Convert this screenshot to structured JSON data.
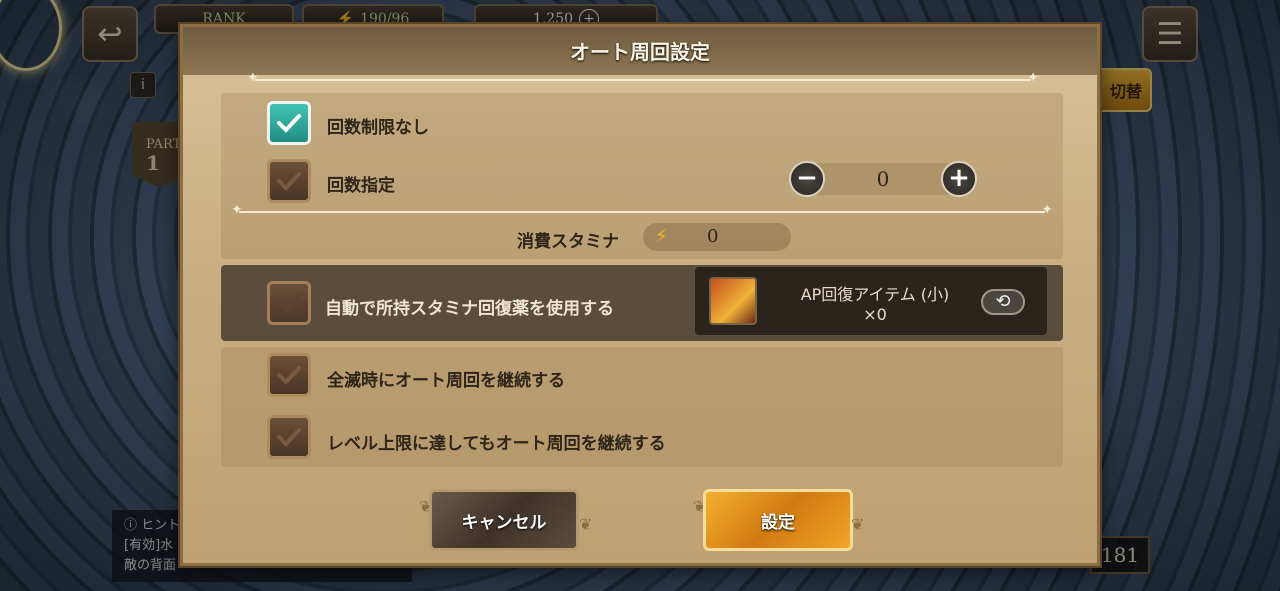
{
  "background": {
    "rank_label": "RANK",
    "stamina": "190/96",
    "currency": "1,250",
    "party_label": "PART",
    "party_number": "1",
    "switch_label": "切替",
    "info_icon": "i",
    "hint_title": "ヒント",
    "hint_line1": "[有効]水",
    "hint_line2": "敵の背面",
    "count": "181"
  },
  "dialog": {
    "title": "オート周回設定",
    "options": {
      "no_limit_label": "回数制限なし",
      "no_limit_checked": true,
      "set_count_label": "回数指定",
      "set_count_checked": false,
      "count_value": "0",
      "minus_symbol": "−",
      "plus_symbol": "+"
    },
    "stamina": {
      "label": "消費スタミナ",
      "value": "0"
    },
    "auto_recover": {
      "label": "自動で所持スタミナ回復薬を使用する",
      "checked": false,
      "item_name": "AP回復アイテム (小)",
      "item_qty": "×0"
    },
    "continue_wipe_label": "全滅時にオート周回を継続する",
    "continue_wipe_checked": false,
    "continue_level_label": "レベル上限に達してもオート周回を継続する",
    "continue_level_checked": false,
    "cancel_label": "キャンセル",
    "confirm_label": "設定"
  },
  "icons": {
    "checkmark": "checkmark-icon",
    "bolt": "bolt-icon",
    "swap": "swap-icon"
  }
}
